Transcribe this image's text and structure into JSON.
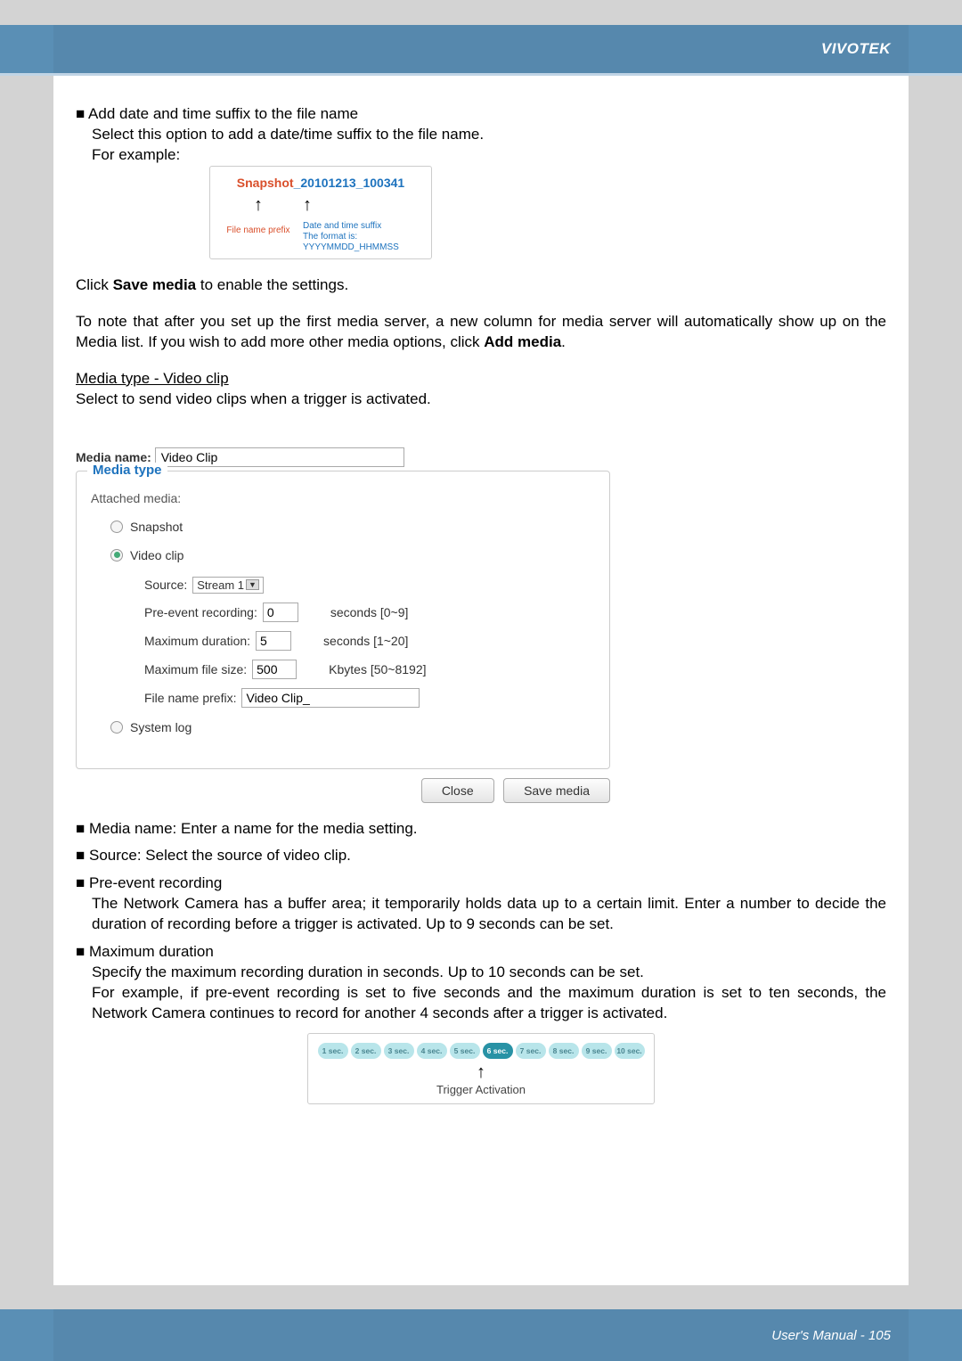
{
  "brand": "VIVOTEK",
  "section1": {
    "bullet": "■ Add date and time suffix to the file name",
    "line1": "Select this option to add a date/time suffix to the file name.",
    "line2": "For example:"
  },
  "snapshot": {
    "prefix": "Snapshot",
    "underscore1": "_",
    "date": "20101213",
    "underscore2": "_",
    "time": "100341",
    "arrow": "↑",
    "label_prefix": "File name prefix",
    "label_suffix1": "Date and time suffix",
    "label_suffix2": "The format is: YYYYMMDD_HHMMSS"
  },
  "click_save": {
    "pre": "Click ",
    "bold": "Save media",
    "post": " to enable the settings."
  },
  "note_para": {
    "pre": "To note that after you set up the first media server, a new column for media server will automatically show up on the Media list.  If you wish to add more other media options, click ",
    "bold": "Add media",
    "post": "."
  },
  "media_type_heading": "Media type - Video clip",
  "media_type_sub": "Select to send video clips when a trigger is activated.",
  "dialog": {
    "media_name_label": "Media name:",
    "media_name_value": "Video Clip",
    "legend": "Media type",
    "attached": "Attached media:",
    "radio_snapshot": "Snapshot",
    "radio_videoclip": "Video clip",
    "source_label": "Source:",
    "source_value": "Stream 1",
    "preevent_label": "Pre-event recording:",
    "preevent_value": "0",
    "preevent_unit": "seconds [0~9]",
    "maxdur_label": "Maximum duration:",
    "maxdur_value": "5",
    "maxdur_unit": "seconds [1~20]",
    "maxsize_label": "Maximum file size:",
    "maxsize_value": "500",
    "maxsize_unit": "Kbytes [50~8192]",
    "prefix_label": "File name prefix:",
    "prefix_value": "Video Clip_",
    "radio_syslog": "System log",
    "btn_close": "Close",
    "btn_save": "Save media"
  },
  "bullets": {
    "b1": "■ Media name: Enter a name for the media setting.",
    "b2": "■ Source: Select the source of video clip.",
    "b3_title": "■ Pre-event recording",
    "b3_body": "The Network Camera has a buffer area; it temporarily holds data up to a certain limit. Enter a number to decide the duration of recording before a trigger is activated. Up to 9 seconds can be set.",
    "b4_title": "■ Maximum duration",
    "b4_body1": "Specify the maximum recording duration in seconds. Up to 10 seconds can be set.",
    "b4_body2": "For example, if pre-event recording is set to five seconds and the maximum duration is set to ten seconds, the Network Camera continues to record for another 4 seconds after a trigger is activated."
  },
  "trigger": {
    "pills": [
      "1 sec.",
      "2 sec.",
      "3 sec.",
      "4 sec.",
      "5 sec.",
      "6 sec.",
      "7 sec.",
      "8 sec.",
      "9 sec.",
      "10 sec."
    ],
    "activeIndex": 5,
    "arrow": "↑",
    "label": "Trigger Activation"
  },
  "footer": "User's Manual - 105"
}
